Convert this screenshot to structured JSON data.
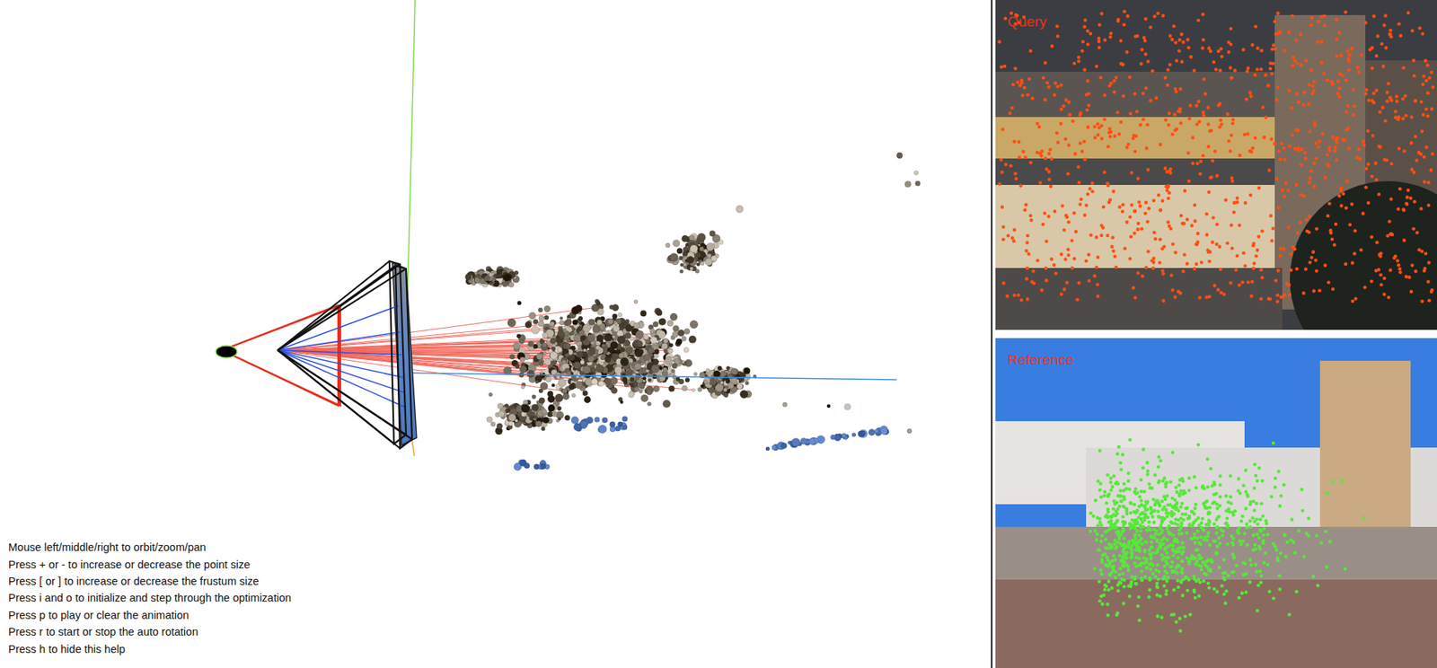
{
  "viewer": {
    "help": [
      "Mouse left/middle/right to orbit/zoom/pan",
      "Press + or - to increase or decrease the point size",
      "Press [ or ] to increase or decrease the frustum size",
      "Press i and o to initialize and step through the optimization",
      "Press p to play or clear the animation",
      "Press r to start or stop the auto rotation",
      "Press h to hide this help"
    ]
  },
  "images": [
    {
      "label": "Query",
      "color": "#ff4f12"
    },
    {
      "label": "Reference",
      "color": "#57e83a"
    }
  ]
}
